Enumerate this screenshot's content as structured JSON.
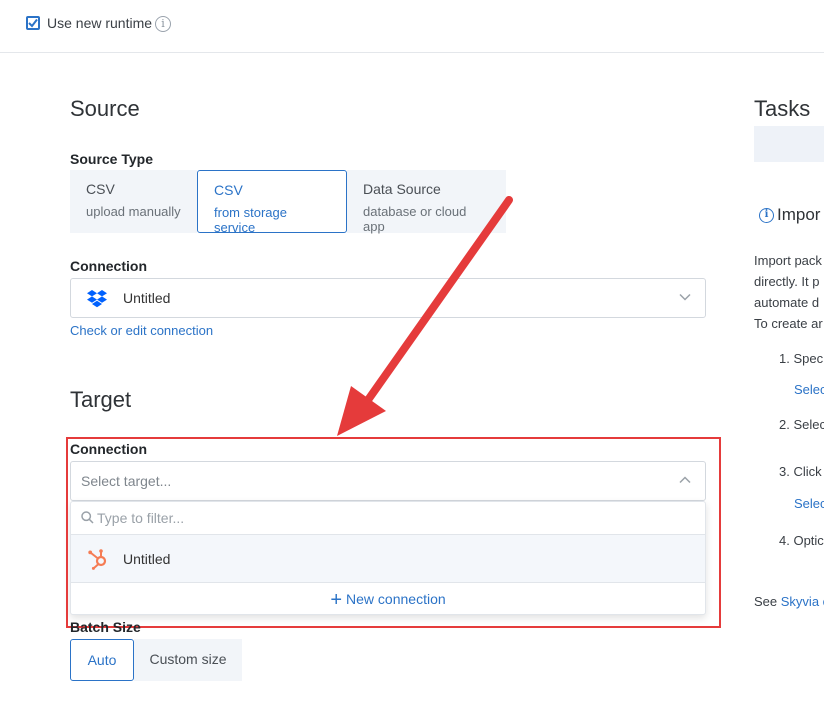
{
  "runtime": {
    "label": "Use new runtime",
    "checked": true,
    "info_glyph": "i"
  },
  "source": {
    "heading": "Source",
    "type_label": "Source Type",
    "types": [
      {
        "line1": "CSV",
        "line2": "upload manually",
        "active": false
      },
      {
        "line1": "CSV",
        "line2": "from storage service",
        "active": true
      },
      {
        "line1": "Data Source",
        "line2": "database or cloud app",
        "active": false
      }
    ],
    "connection_label": "Connection",
    "connection_value": "Untitled",
    "connection_icon": "dropbox-icon",
    "check_link": "Check or edit connection"
  },
  "target": {
    "heading": "Target",
    "connection_label": "Connection",
    "placeholder": "Select target...",
    "filter_placeholder": "Type to filter...",
    "option_label": "Untitled",
    "option_icon": "hubspot-icon",
    "new_connection_label": "New connection",
    "batch_label": "Batch Size",
    "batch_options": [
      "Auto",
      "Custom size"
    ],
    "batch_selected": "Auto"
  },
  "tasks": {
    "heading": "Tasks",
    "import_title": "Impor",
    "desc_lines": [
      "Import pack",
      "directly. It p",
      "automate d",
      "To create ar"
    ],
    "steps": [
      {
        "num": "1.",
        "text": "Spec",
        "sub": "Selec"
      },
      {
        "num": "2.",
        "text": "Selec",
        "sub": ""
      },
      {
        "num": "3.",
        "text": "Click",
        "sub": "Selec"
      },
      {
        "num": "4.",
        "text": "Optic",
        "sub": ""
      }
    ],
    "see_prefix": "See",
    "see_link": "Skyvia c"
  },
  "colors": {
    "accent": "#2b73c7",
    "annotation": "#e53b3b",
    "hubspot": "#f57c54",
    "dropbox": "#0061fe"
  }
}
